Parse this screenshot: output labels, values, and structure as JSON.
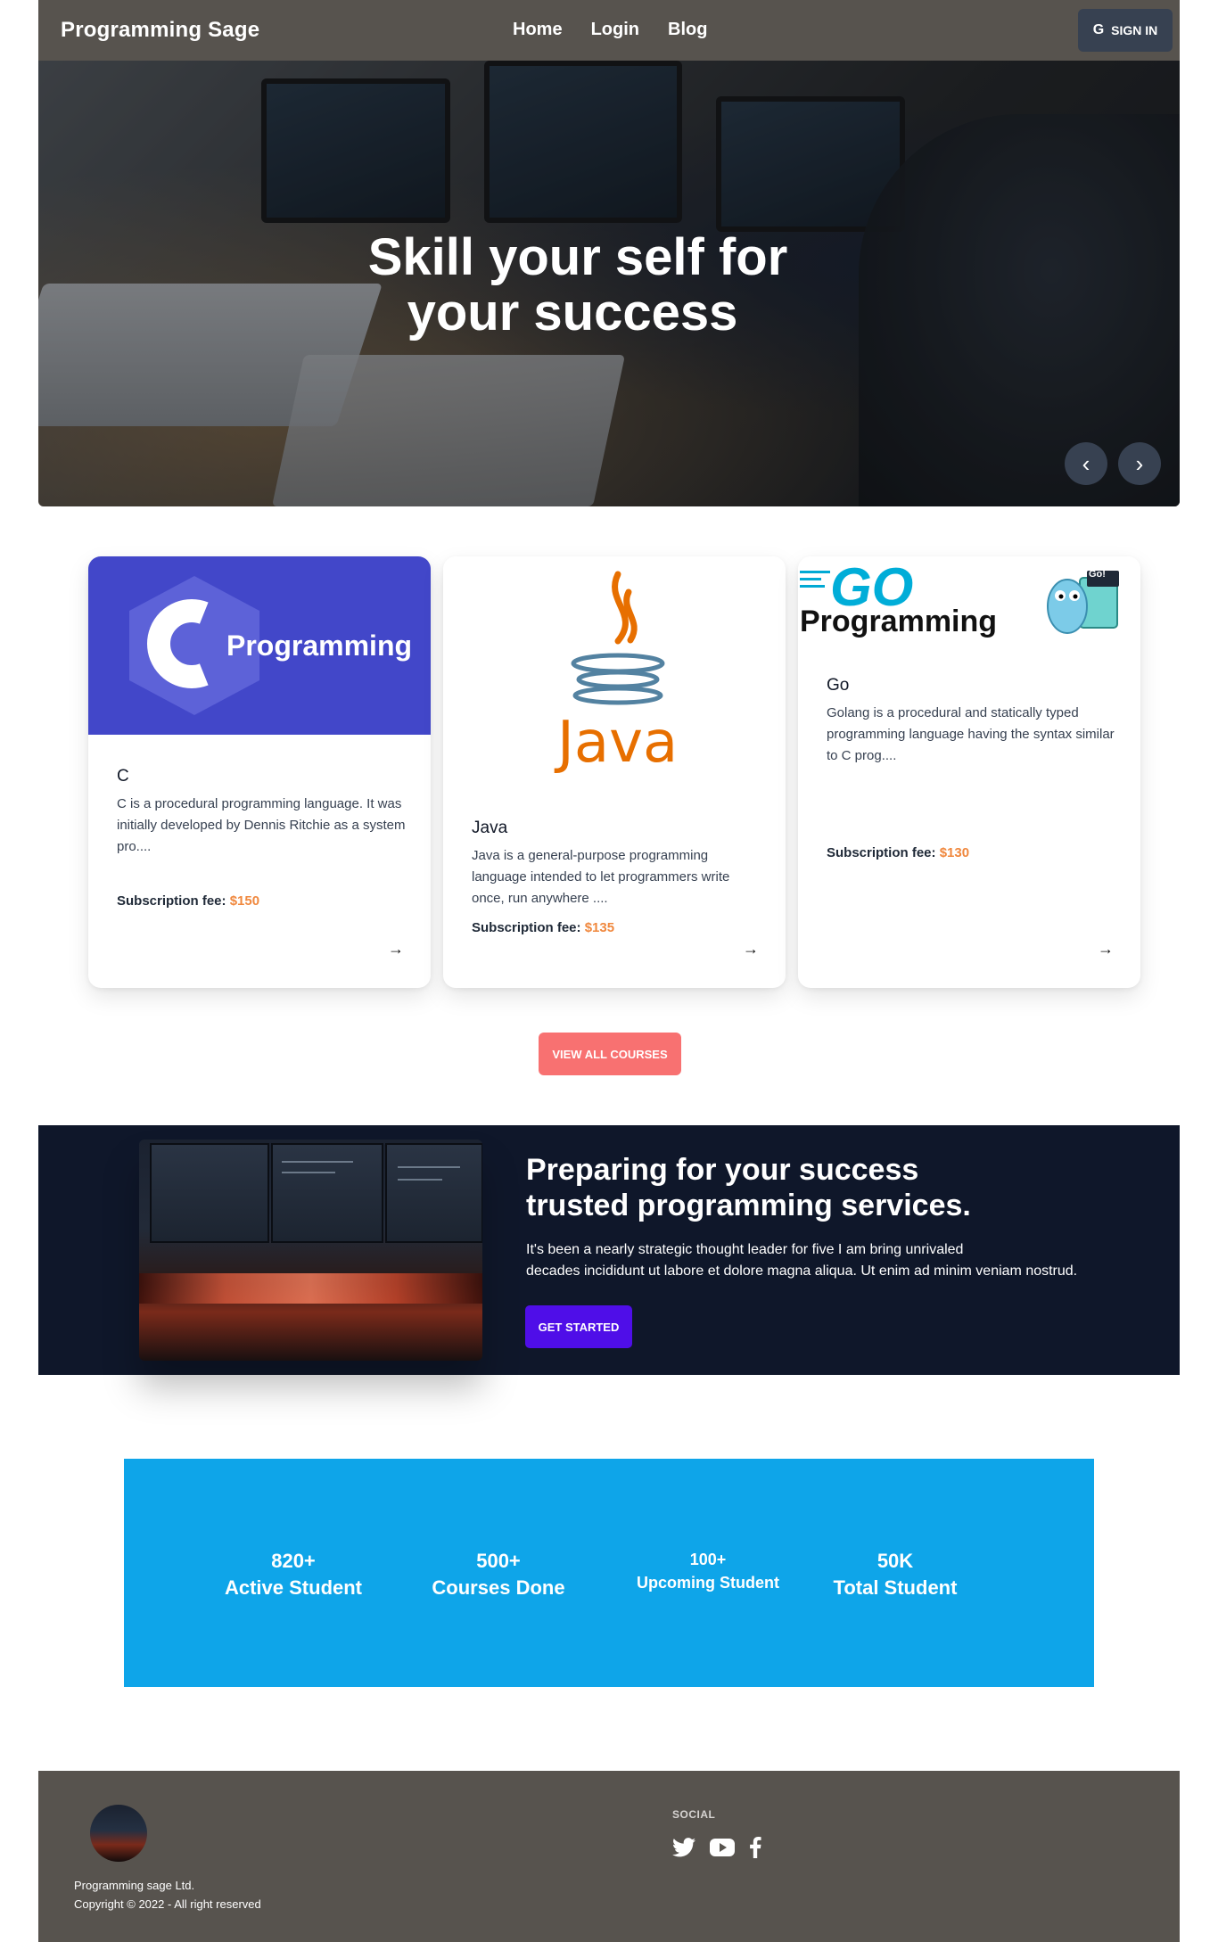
{
  "navbar": {
    "brand": "Programming Sage",
    "links": [
      "Home",
      "Login",
      "Blog"
    ],
    "signin_icon": "G",
    "signin_label": "SIGN IN"
  },
  "hero": {
    "title_line1": "Skill your self for",
    "title_line2": "your success",
    "prev_icon": "‹",
    "next_icon": "›"
  },
  "courses": [
    {
      "title": "C",
      "image_text": "Programming",
      "description": "C is a procedural programming language. It was initially developed by Dennis Ritchie as a system pro....",
      "fee_label": "Subscription fee:",
      "fee": "$150"
    },
    {
      "title": "Java",
      "image_text": "Java",
      "description": "Java is a general-purpose programming language intended to let programmers write once, run anywhere ....",
      "fee_label": "Subscription fee:",
      "fee": "$135"
    },
    {
      "title": "Go",
      "image_text_1": "GO",
      "image_text_2": "Programming",
      "image_badge": "Go!",
      "description": "Golang is a procedural and statically typed programming language having the syntax similar to C prog....",
      "fee_label": "Subscription fee:",
      "fee": "$130"
    }
  ],
  "arrow_icon": "→",
  "view_all_label": "VIEW ALL COURSES",
  "banner": {
    "title_line1": "Preparing for your success",
    "title_line2": "trusted programming services.",
    "text_line1": "It's been a nearly strategic thought leader for five I am bring unrivaled",
    "text_line2": "decades incididunt ut labore et dolore magna aliqua. Ut enim ad minim veniam nostrud.",
    "button_label": "GET STARTED"
  },
  "stats": [
    {
      "number": "820+",
      "label": "Active Student"
    },
    {
      "number": "500+",
      "label": "Courses Done"
    },
    {
      "number": "100+",
      "label": "Upcoming Student"
    },
    {
      "number": "50K",
      "label": "Total Student"
    }
  ],
  "footer": {
    "company": "Programming sage Ltd.",
    "copyright": "Copyright © 2022 - All right reserved",
    "social_heading": "SOCIAL",
    "social_icons": [
      "twitter-icon",
      "youtube-icon",
      "facebook-icon"
    ]
  },
  "colors": {
    "navbar": "#57534e",
    "fee": "#f0883e",
    "view_all": "#f87171",
    "banner": "#0f172a",
    "get_started": "#4f0ee8",
    "stats": "#0ea5e9"
  }
}
